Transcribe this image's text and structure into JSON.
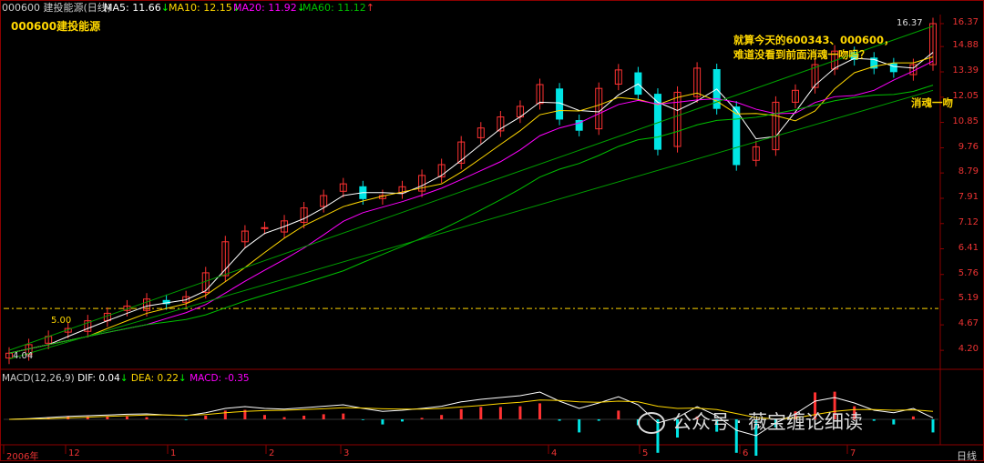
{
  "header": {
    "code_name": "000600 建投能源(日线)",
    "ma5": "MA5: 11.66",
    "ma10": "MA10: 12.15",
    "ma20": "MA20: 11.92",
    "ma60": "MA60: 11.12",
    "arrow_up": "↑",
    "arrow_down": "↓"
  },
  "title": "000600建投能源",
  "annotation_line1": "就算今天的600343、000600，",
  "annotation_line2": "难道没看到前面消魂一吻吗？",
  "kiss_label": "消魂一吻",
  "price_high": "16.37",
  "price_low": "4.04",
  "level_label": "5.00",
  "watermark": "公众号 · 薇宝缠论细读",
  "macd_header": {
    "params": "MACD(12,26,9)",
    "dif": "DIF: 0.04",
    "dea": "DEA: 0.22",
    "macd": "MACD: -0.35"
  },
  "period_label": "日线",
  "colors": {
    "up": "#ff3232",
    "down": "#00e5e5",
    "ma5": "#ffffff",
    "ma10": "#ffd700",
    "ma20": "#ff00ff",
    "ma60": "#00c000",
    "zigzag": "#00a000",
    "macd_dif": "#ffffff",
    "macd_dea": "#ffd700"
  },
  "chart_data": {
    "type": "candlestick",
    "x_ticks": [
      "2006年",
      "12",
      "1",
      "2",
      "3",
      "4",
      "5",
      "6",
      "7",
      "8"
    ],
    "y_ticks": [
      16.37,
      14.88,
      13.39,
      12.05,
      10.85,
      9.76,
      8.79,
      7.91,
      7.12,
      6.41,
      5.76,
      5.19,
      4.67,
      4.2
    ],
    "y_scale": "log",
    "ylim": [
      4.0,
      17.0
    ],
    "level_line": 5.0,
    "closes": [
      4.15,
      4.3,
      4.45,
      4.6,
      4.75,
      4.9,
      5.05,
      5.2,
      5.1,
      5.25,
      5.8,
      6.6,
      6.9,
      7.0,
      7.2,
      7.6,
      8.0,
      8.4,
      7.9,
      8.0,
      8.3,
      8.7,
      9.1,
      10.0,
      10.6,
      11.1,
      11.6,
      12.7,
      11.0,
      10.5,
      12.5,
      13.5,
      12.2,
      9.7,
      12.3,
      13.6,
      11.5,
      9.1,
      9.8,
      11.8,
      12.4,
      13.8,
      14.6,
      14.1,
      13.6,
      13.4,
      13.8,
      16.37
    ],
    "macd_dif": [
      0.0,
      0.02,
      0.05,
      0.08,
      0.1,
      0.12,
      0.14,
      0.15,
      0.12,
      0.1,
      0.18,
      0.3,
      0.35,
      0.3,
      0.28,
      0.32,
      0.36,
      0.4,
      0.3,
      0.22,
      0.25,
      0.3,
      0.36,
      0.48,
      0.55,
      0.6,
      0.65,
      0.75,
      0.5,
      0.3,
      0.45,
      0.62,
      0.4,
      -0.1,
      0.05,
      0.35,
      0.1,
      -0.3,
      -0.45,
      -0.1,
      0.15,
      0.5,
      0.6,
      0.45,
      0.25,
      0.18,
      0.3,
      0.04
    ],
    "macd_dea": [
      0.0,
      0.01,
      0.02,
      0.04,
      0.06,
      0.08,
      0.1,
      0.12,
      0.12,
      0.11,
      0.13,
      0.18,
      0.22,
      0.24,
      0.25,
      0.27,
      0.29,
      0.32,
      0.31,
      0.29,
      0.28,
      0.28,
      0.3,
      0.34,
      0.38,
      0.43,
      0.47,
      0.53,
      0.52,
      0.48,
      0.47,
      0.5,
      0.48,
      0.36,
      0.3,
      0.31,
      0.27,
      0.16,
      0.05,
      0.01,
      0.04,
      0.13,
      0.22,
      0.27,
      0.27,
      0.25,
      0.26,
      0.22
    ]
  }
}
